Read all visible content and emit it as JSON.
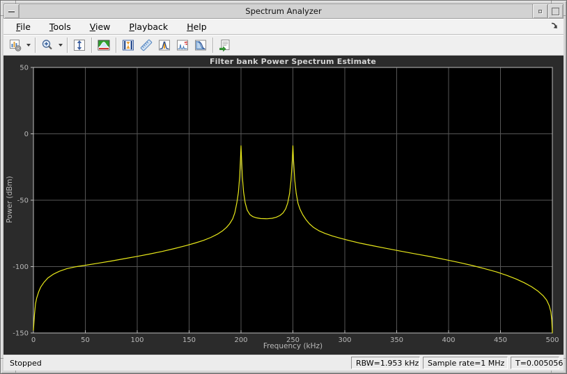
{
  "window": {
    "title": "Spectrum Analyzer"
  },
  "menubar": {
    "items": [
      {
        "label": "File",
        "mnemonic": "F"
      },
      {
        "label": "Tools",
        "mnemonic": "T"
      },
      {
        "label": "View",
        "mnemonic": "V"
      },
      {
        "label": "Playback",
        "mnemonic": "P"
      },
      {
        "label": "Help",
        "mnemonic": "H"
      }
    ],
    "dock_icon": "dock-arrow-icon"
  },
  "toolbar": {
    "buttons": [
      {
        "name": "spectrum-options",
        "icon": "chart-gear-icon",
        "dropdown": true
      },
      {
        "name": "zoom",
        "icon": "zoom-in-icon",
        "dropdown": true
      },
      {
        "name": "autoscale-y",
        "icon": "fit-vertical-axis-icon",
        "dropdown": false
      },
      {
        "name": "spectrum-view",
        "icon": "spectrum-view-icon",
        "dropdown": false
      },
      {
        "name": "cursor-measurements",
        "icon": "cursors-icon",
        "dropdown": false
      },
      {
        "name": "spectral-mask",
        "icon": "ruler-icon",
        "dropdown": false
      },
      {
        "name": "peak-finder",
        "icon": "peak-finder-icon",
        "dropdown": false
      },
      {
        "name": "distortion-measurements",
        "icon": "distortion-icon",
        "dropdown": false
      },
      {
        "name": "ccdf-measurements",
        "icon": "rolloff-curve-icon",
        "dropdown": false
      },
      {
        "name": "generate-script",
        "icon": "script-document-icon",
        "dropdown": false
      }
    ]
  },
  "chart_data": {
    "type": "line",
    "title": "Filter bank Power Spectrum Estimate",
    "xlabel": "Frequency (kHz)",
    "ylabel": "Power (dBm)",
    "xlim": [
      0,
      500
    ],
    "ylim": [
      -150,
      50
    ],
    "x_ticks": [
      0,
      50,
      100,
      150,
      200,
      250,
      300,
      350,
      400,
      450,
      500
    ],
    "y_ticks": [
      50,
      0,
      -50,
      -100,
      -150
    ],
    "grid": true,
    "legend": "none",
    "colors": {
      "line": "#e8e81a",
      "plot_bg": "#000000",
      "figure_bg": "#2b2b2b",
      "grid": "#565656",
      "axis": "#bebebe",
      "text": "#b8b8b8",
      "title_text": "#d4d4d4"
    },
    "series": [
      {
        "name": "power-spectrum",
        "points": [
          [
            0,
            -148
          ],
          [
            1,
            -136
          ],
          [
            2,
            -128
          ],
          [
            3,
            -124
          ],
          [
            5,
            -119
          ],
          [
            7,
            -115.5
          ],
          [
            10,
            -112
          ],
          [
            14,
            -108.5
          ],
          [
            19,
            -105.8
          ],
          [
            25,
            -103.5
          ],
          [
            32,
            -101.6
          ],
          [
            40,
            -100.2
          ],
          [
            50,
            -99
          ],
          [
            62,
            -97.5
          ],
          [
            75,
            -95.8
          ],
          [
            88,
            -94
          ],
          [
            100,
            -92.3
          ],
          [
            112,
            -90.5
          ],
          [
            124,
            -88.6
          ],
          [
            136,
            -86.4
          ],
          [
            147,
            -84.2
          ],
          [
            156,
            -82.2
          ],
          [
            164,
            -80.2
          ],
          [
            171,
            -78
          ],
          [
            177,
            -75.7
          ],
          [
            182,
            -73.2
          ],
          [
            186,
            -70.5
          ],
          [
            189,
            -67.8
          ],
          [
            192,
            -64
          ],
          [
            194,
            -59.5
          ],
          [
            196,
            -52
          ],
          [
            197.5,
            -44
          ],
          [
            198.7,
            -32
          ],
          [
            199.6,
            -17
          ],
          [
            200,
            -9
          ],
          [
            200.4,
            -17
          ],
          [
            201.3,
            -32
          ],
          [
            202.5,
            -44
          ],
          [
            204,
            -52
          ],
          [
            206,
            -57.5
          ],
          [
            208.5,
            -60.8
          ],
          [
            211.5,
            -62.4
          ],
          [
            215,
            -63.3
          ],
          [
            219,
            -63.8
          ],
          [
            225,
            -64
          ],
          [
            230,
            -63.6
          ],
          [
            234,
            -62.8
          ],
          [
            237.5,
            -61.5
          ],
          [
            240.5,
            -59.6
          ],
          [
            243,
            -56.5
          ],
          [
            245,
            -52
          ],
          [
            246.8,
            -45
          ],
          [
            248.2,
            -35
          ],
          [
            249.4,
            -20
          ],
          [
            250,
            -9
          ],
          [
            250.6,
            -20
          ],
          [
            251.8,
            -35
          ],
          [
            253.2,
            -45
          ],
          [
            255,
            -52.5
          ],
          [
            257,
            -57
          ],
          [
            259.5,
            -61
          ],
          [
            262.5,
            -64.5
          ],
          [
            266,
            -67.8
          ],
          [
            270,
            -70.6
          ],
          [
            275,
            -73
          ],
          [
            281,
            -75
          ],
          [
            288,
            -76.9
          ],
          [
            296,
            -78.7
          ],
          [
            305,
            -80.5
          ],
          [
            315,
            -82.4
          ],
          [
            327,
            -84.3
          ],
          [
            340,
            -86.3
          ],
          [
            354,
            -88.4
          ],
          [
            368,
            -90.4
          ],
          [
            382,
            -92.4
          ],
          [
            396,
            -94.6
          ],
          [
            410,
            -96.9
          ],
          [
            423,
            -99.2
          ],
          [
            435,
            -101.6
          ],
          [
            446,
            -104
          ],
          [
            456,
            -106.6
          ],
          [
            465,
            -109.3
          ],
          [
            473,
            -112.2
          ],
          [
            480,
            -115.2
          ],
          [
            486,
            -118.4
          ],
          [
            491,
            -121.9
          ],
          [
            494.5,
            -125.3
          ],
          [
            497,
            -129.5
          ],
          [
            498.5,
            -134
          ],
          [
            499.4,
            -140
          ],
          [
            500,
            -150
          ]
        ]
      }
    ]
  },
  "statusbar": {
    "state": "Stopped",
    "rbw": "RBW=1.953 kHz",
    "sample_rate": "Sample rate=1 MHz",
    "time": "T=0.005056"
  }
}
